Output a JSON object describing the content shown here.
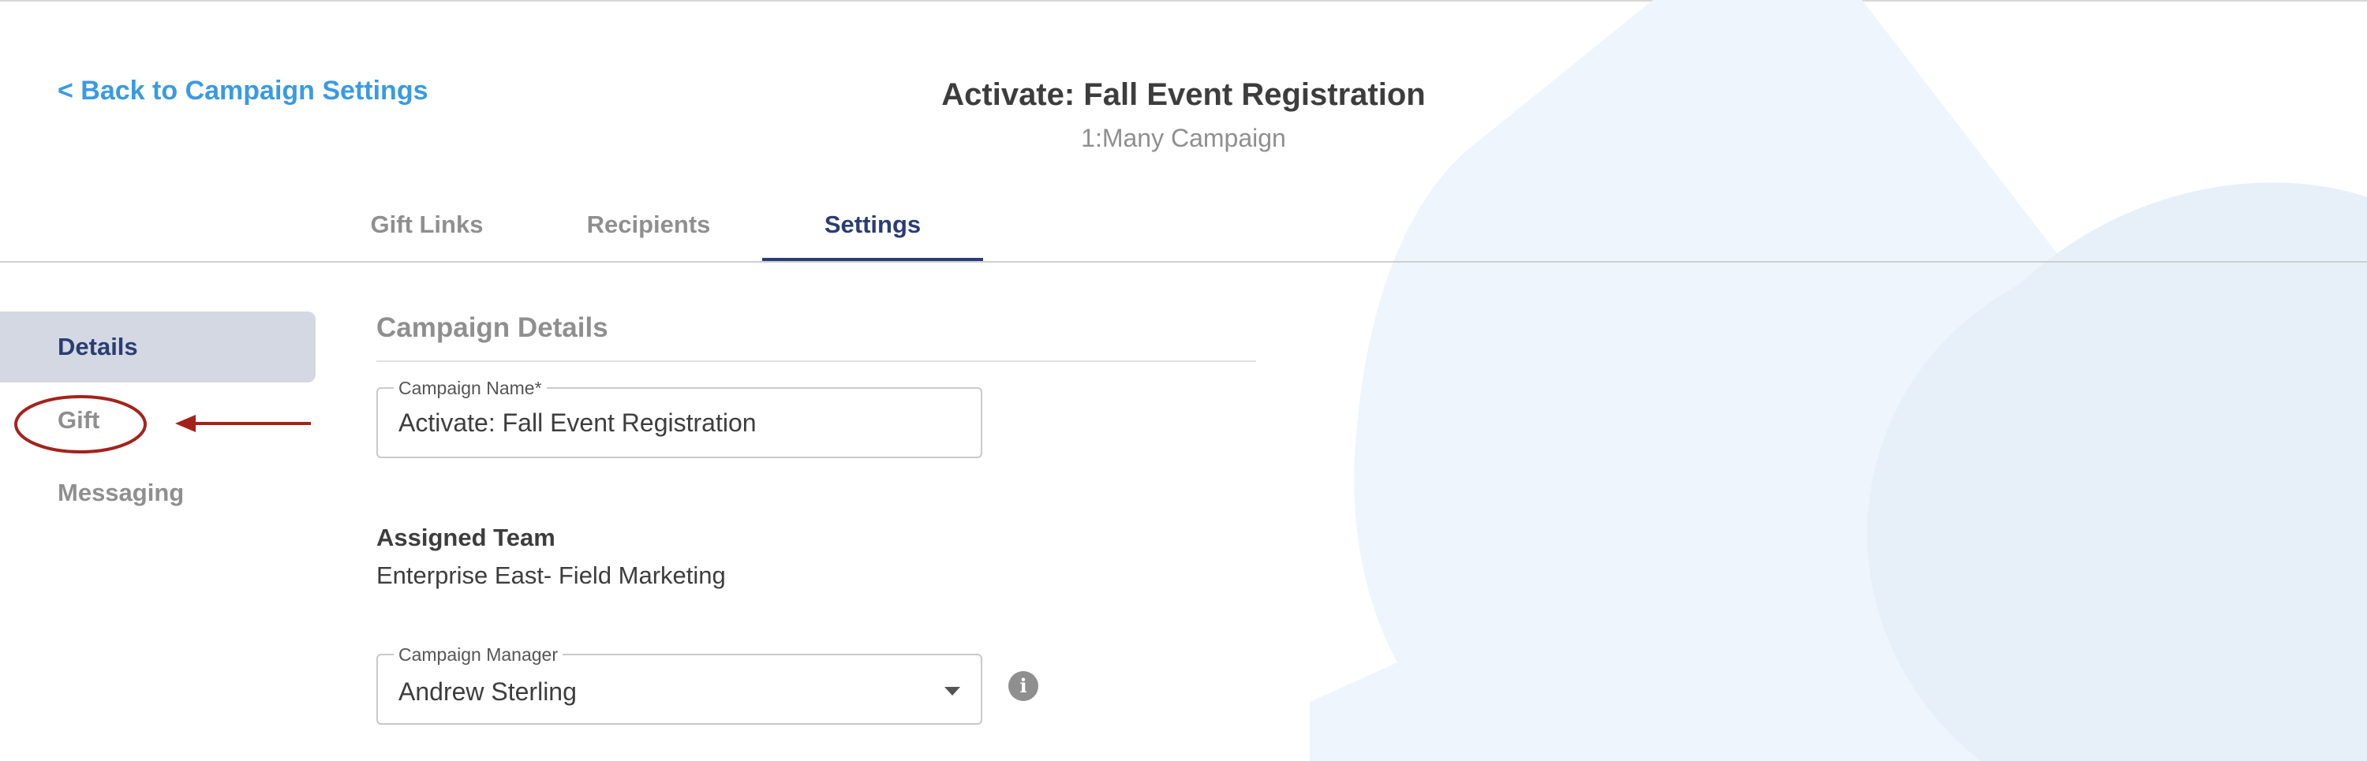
{
  "header": {
    "back_link": "< Back to Campaign Settings",
    "title": "Activate: Fall Event Registration",
    "subtitle": "1:Many Campaign"
  },
  "tabs": [
    {
      "label": "Gift Links",
      "active": false
    },
    {
      "label": "Recipients",
      "active": false
    },
    {
      "label": "Settings",
      "active": true
    }
  ],
  "sidebar": {
    "items": [
      {
        "label": "Details",
        "active": true
      },
      {
        "label": "Gift",
        "active": false,
        "highlighted": true
      },
      {
        "label": "Messaging",
        "active": false
      }
    ]
  },
  "section": {
    "title": "Campaign Details"
  },
  "form": {
    "campaign_name": {
      "label": "Campaign Name",
      "required_mark": "*",
      "value": "Activate: Fall Event Registration"
    },
    "assigned_team": {
      "label": "Assigned Team",
      "value": "Enterprise East- Field Marketing"
    },
    "campaign_manager": {
      "label": "Campaign Manager",
      "value": "Andrew Sterling"
    }
  },
  "icons": {
    "info": "info-icon",
    "dropdown": "chevron-down-icon",
    "annotation": "arrow-left-icon"
  },
  "colors": {
    "accent_link": "#3a9ae2",
    "active_nav": "#2a3d73",
    "active_sidebar_bg": "#d4d8e3",
    "annotation": "#a3231b",
    "background_art": "#eef5fc"
  }
}
